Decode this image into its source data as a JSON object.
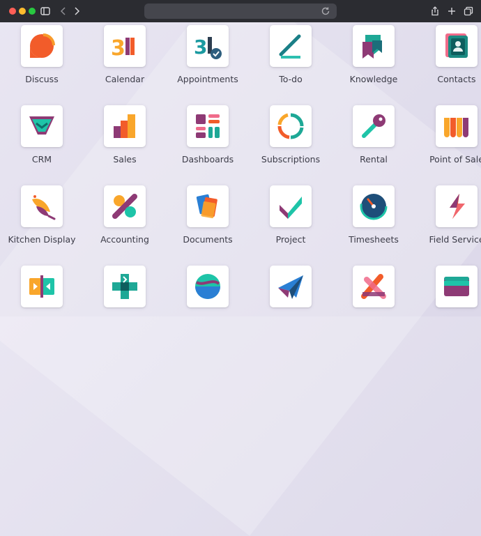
{
  "browser": {
    "window_controls": [
      "close",
      "minimize",
      "zoom"
    ],
    "toolbar_icons": [
      "sidebar-icon",
      "back-icon",
      "forward-icon",
      "share-icon",
      "new-tab-icon",
      "tabs-overview-icon"
    ],
    "address_value": ""
  },
  "apps": [
    {
      "label": "Discuss",
      "icon": "discuss-icon"
    },
    {
      "label": "Calendar",
      "icon": "calendar-icon"
    },
    {
      "label": "Appointments",
      "icon": "appointments-icon"
    },
    {
      "label": "To-do",
      "icon": "todo-icon"
    },
    {
      "label": "Knowledge",
      "icon": "knowledge-icon"
    },
    {
      "label": "Contacts",
      "icon": "contacts-icon"
    },
    {
      "label": "CRM",
      "icon": "crm-icon"
    },
    {
      "label": "Sales",
      "icon": "sales-icon"
    },
    {
      "label": "Dashboards",
      "icon": "dashboards-icon"
    },
    {
      "label": "Subscriptions",
      "icon": "subscriptions-icon"
    },
    {
      "label": "Rental",
      "icon": "rental-icon"
    },
    {
      "label": "Point of Sale",
      "icon": "point-of-sale-icon"
    },
    {
      "label": "Kitchen Display",
      "icon": "kitchen-display-icon"
    },
    {
      "label": "Accounting",
      "icon": "accounting-icon"
    },
    {
      "label": "Documents",
      "icon": "documents-icon"
    },
    {
      "label": "Project",
      "icon": "project-icon"
    },
    {
      "label": "Timesheets",
      "icon": "timesheets-icon"
    },
    {
      "label": "Field Service",
      "icon": "field-service-icon"
    },
    {
      "label": "",
      "icon": "planning-icon"
    },
    {
      "label": "",
      "icon": "helpdesk-icon"
    },
    {
      "label": "",
      "icon": "website-icon"
    },
    {
      "label": "",
      "icon": "email-marketing-icon"
    },
    {
      "label": "",
      "icon": "events-icon"
    },
    {
      "label": "",
      "icon": "payments-icon"
    }
  ]
}
